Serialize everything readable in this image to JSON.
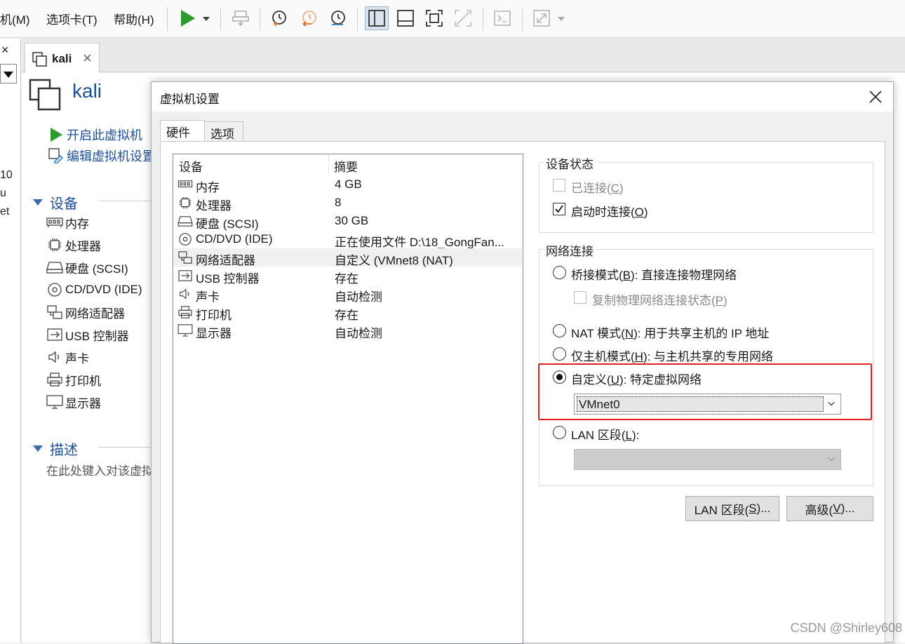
{
  "menu": {
    "vm": "机(M)",
    "tabs": "选项卡(T)",
    "help": "帮助(H)"
  },
  "left_stub": {
    "close": "×",
    "text1": "10",
    "text2": "u",
    "text3": "et"
  },
  "tab": {
    "label": "kali",
    "close": "×"
  },
  "vm": {
    "name": "kali",
    "actions": {
      "power_on": "开启此虚拟机",
      "edit_settings": "编辑虚拟机设置"
    },
    "devices_section": "设备",
    "devices": [
      "内存",
      "处理器",
      "硬盘 (SCSI)",
      "CD/DVD (IDE)",
      "网络适配器",
      "USB 控制器",
      "声卡",
      "打印机",
      "显示器"
    ],
    "description_section": "描述",
    "description_placeholder": "在此处键入对该虚拟"
  },
  "dialog": {
    "title": "虚拟机设置",
    "tabs": {
      "hardware": "硬件",
      "options": "选项"
    },
    "list_headers": {
      "device": "设备",
      "summary": "摘要"
    },
    "device_rows": [
      {
        "name": "内存",
        "summary": "4 GB"
      },
      {
        "name": "处理器",
        "summary": "8"
      },
      {
        "name": "硬盘 (SCSI)",
        "summary": "30 GB"
      },
      {
        "name": "CD/DVD (IDE)",
        "summary": "正在使用文件 D:\\18_GongFan..."
      },
      {
        "name": "网络适配器",
        "summary": "自定义 (VMnet8 (NAT)"
      },
      {
        "name": "USB 控制器",
        "summary": "存在"
      },
      {
        "name": "声卡",
        "summary": "自动检测"
      },
      {
        "name": "打印机",
        "summary": "存在"
      },
      {
        "name": "显示器",
        "summary": "自动检测"
      }
    ],
    "device_status": {
      "title": "设备状态",
      "connected": {
        "pre": "已连接(",
        "key": "C",
        "post": ")",
        "checked": false,
        "enabled": false
      },
      "connect_at_power_on": {
        "pre": "启动时连接(",
        "key": "O",
        "post": ")",
        "checked": true
      }
    },
    "network": {
      "title": "网络连接",
      "bridged": {
        "pre": "桥接模式(",
        "key": "B",
        "post": "): 直接连接物理网络"
      },
      "replicate": {
        "pre": "复制物理网络连接状态(",
        "key": "P",
        "post": ")"
      },
      "nat": {
        "pre": "NAT 模式(",
        "key": "N",
        "post": "): 用于共享主机的 IP 地址"
      },
      "host_only": {
        "pre": "仅主机模式(",
        "key": "H",
        "post": "): 与主机共享的专用网络"
      },
      "custom": {
        "pre": "自定义(",
        "key": "U",
        "post": "): 特定虚拟网络"
      },
      "custom_value": "VMnet0",
      "lan": {
        "pre": "LAN 区段(",
        "key": "L",
        "post": "):"
      },
      "selected": "custom",
      "highlight_color": "#e02020"
    },
    "buttons": {
      "lan_segments": {
        "pre": "LAN 区段(",
        "key": "S",
        "post": ")..."
      },
      "advanced": {
        "pre": "高级(",
        "key": "V",
        "post": ")..."
      }
    }
  },
  "watermark": "CSDN @Shirley608"
}
